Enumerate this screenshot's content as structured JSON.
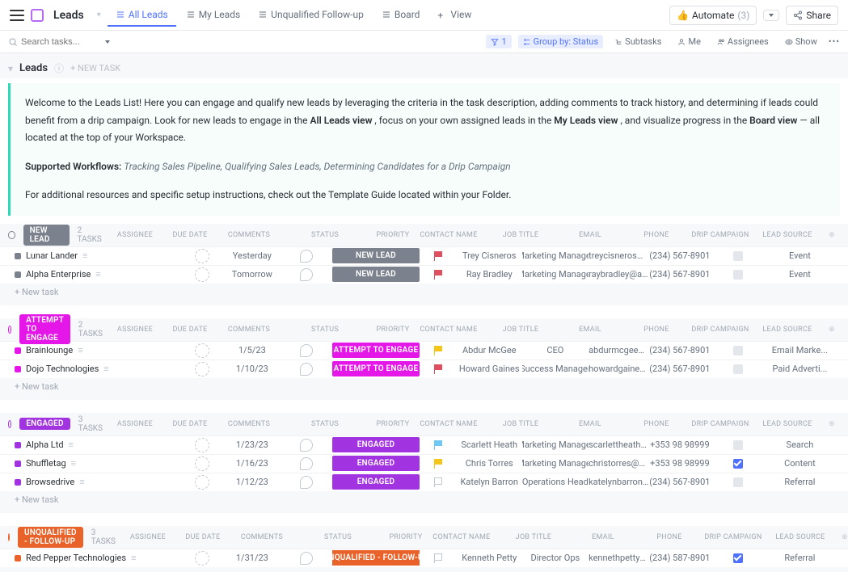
{
  "header": {
    "listTitle": "Leads",
    "views": [
      {
        "label": "All Leads",
        "active": true
      },
      {
        "label": "My Leads",
        "active": false
      },
      {
        "label": "Unqualified Follow-up",
        "active": false
      },
      {
        "label": "Board",
        "active": false
      },
      {
        "label": "View",
        "active": false,
        "isAdd": true
      }
    ],
    "automate": {
      "label": "Automate",
      "count": "(3)"
    },
    "share": "Share"
  },
  "toolbar": {
    "searchPlaceholder": "Search tasks...",
    "filter": "1",
    "groupBy": "Group by: Status",
    "subtasks": "Subtasks",
    "me": "Me",
    "assignees": "Assignees",
    "show": "Show"
  },
  "listRow": {
    "title": "Leads",
    "newTask": "+ NEW TASK"
  },
  "banner": {
    "p1a": "Welcome to the Leads List! Here you can engage and qualify new leads by leveraging the criteria in the task description, adding comments to track history, and determining if leads could benefit from a drip campaign. Look for new leads to engage in the ",
    "p1b": "All Leads view",
    "p1c": ", focus on your own assigned leads in the ",
    "p1d": "My Leads view",
    "p1e": ", and visualize progress in the ",
    "p1f": "Board view",
    "p1g": " — all located at the top of your Workspace.",
    "p2a": "Supported Workflows: ",
    "p2b": "Tracking Sales Pipeline,  Qualifying Sales Leads, Determining Candidates for a Drip Campaign",
    "p3": "For additional resources and specific setup instructions, check out the Template Guide located within your Folder."
  },
  "columns": [
    "ASSIGNEE",
    "DUE DATE",
    "COMMENTS",
    "STATUS",
    "PRIORITY",
    "CONTACT NAME",
    "JOB TITLE",
    "EMAIL",
    "PHONE",
    "DRIP CAMPAIGN",
    "LEAD SOURCE"
  ],
  "newTaskLabel": "+ New task",
  "groups": [
    {
      "name": "NEW LEAD",
      "color": "#7c828d",
      "countLabel": "2 TASKS",
      "rows": [
        {
          "name": "Lunar Lander",
          "due": "Yesterday",
          "dueRed": true,
          "statusText": "NEW LEAD",
          "statusColor": "#7c828d",
          "flag": "red",
          "contact": "Trey Cisneros",
          "job": "Marketing Manager",
          "email": "treycisneros@lunarla",
          "phone": "(234) 567-8901",
          "drip": false,
          "source": "Event"
        },
        {
          "name": "Alpha Enterprise",
          "due": "Tomorrow",
          "dueRed": false,
          "statusText": "NEW LEAD",
          "statusColor": "#7c828d",
          "flag": "red",
          "contact": "Ray Bradley",
          "job": "Marketing Manager",
          "email": "raybradley@alphaent",
          "phone": "(234) 567-8901",
          "drip": false,
          "source": "Event"
        }
      ]
    },
    {
      "name": "ATTEMPT TO ENGAGE",
      "color": "#e516e8",
      "countLabel": "2 TASKS",
      "rows": [
        {
          "name": "Brainlounge",
          "due": "1/5/23",
          "dueRed": false,
          "statusText": "ATTEMPT TO ENGAGE",
          "statusColor": "#e516e8",
          "flag": "yellow",
          "contact": "Abdur McGee",
          "job": "CEO",
          "email": "abdurmcgee@brainlc",
          "phone": "(234) 567-8901",
          "drip": false,
          "source": "Email Marke..."
        },
        {
          "name": "Dojo Technologies",
          "due": "1/10/23",
          "dueRed": false,
          "statusText": "ATTEMPT TO ENGAGE",
          "statusColor": "#e516e8",
          "flag": "red",
          "contact": "Howard Gaines",
          "job": "Success Manager",
          "email": "howardgaines@dojot",
          "phone": "(234) 567-8901",
          "drip": false,
          "source": "Paid Adverti..."
        }
      ]
    },
    {
      "name": "ENGAGED",
      "color": "#a233e0",
      "countLabel": "3 TASKS",
      "rows": [
        {
          "name": "Alpha Ltd",
          "due": "1/23/23",
          "dueRed": false,
          "statusText": "ENGAGED",
          "statusColor": "#a233e0",
          "flag": "blue",
          "contact": "Scarlett Heath",
          "job": "Marketing Manager",
          "email": "scarlettheath@alphal",
          "phone": "+353 98 98999",
          "drip": false,
          "source": "Search"
        },
        {
          "name": "Shuffletag",
          "due": "1/16/23",
          "dueRed": false,
          "statusText": "ENGAGED",
          "statusColor": "#a233e0",
          "flag": "yellow",
          "contact": "Chris Torres",
          "job": "Marketing Manager",
          "email": "christorres@shufflete",
          "phone": "+353 98 98999",
          "drip": true,
          "source": "Content"
        },
        {
          "name": "Browsedrive",
          "due": "1/12/23",
          "dueRed": false,
          "statusText": "ENGAGED",
          "statusColor": "#a233e0",
          "flag": "grey",
          "contact": "Katelyn Barron",
          "job": "Operations Head",
          "email": "katelynbarron@brows",
          "phone": "(234) 567-8901",
          "drip": false,
          "source": "Referral"
        }
      ]
    },
    {
      "name": "UNQUALIFIED - FOLLOW-UP",
      "color": "#e8622a",
      "countLabel": "3 TASKS",
      "rows": [
        {
          "name": "Red Pepper Technologies",
          "due": "1/31/23",
          "dueRed": false,
          "statusText": "UNQUALIFIED - FOLLOW-UP",
          "statusColor": "#e8622a",
          "flag": "grey",
          "contact": "Kenneth Petty",
          "job": "Director Ops",
          "email": "kennethpetty@redpe",
          "phone": "(234) 587-8901",
          "drip": true,
          "source": "Referral"
        }
      ],
      "noNewTask": true
    }
  ]
}
